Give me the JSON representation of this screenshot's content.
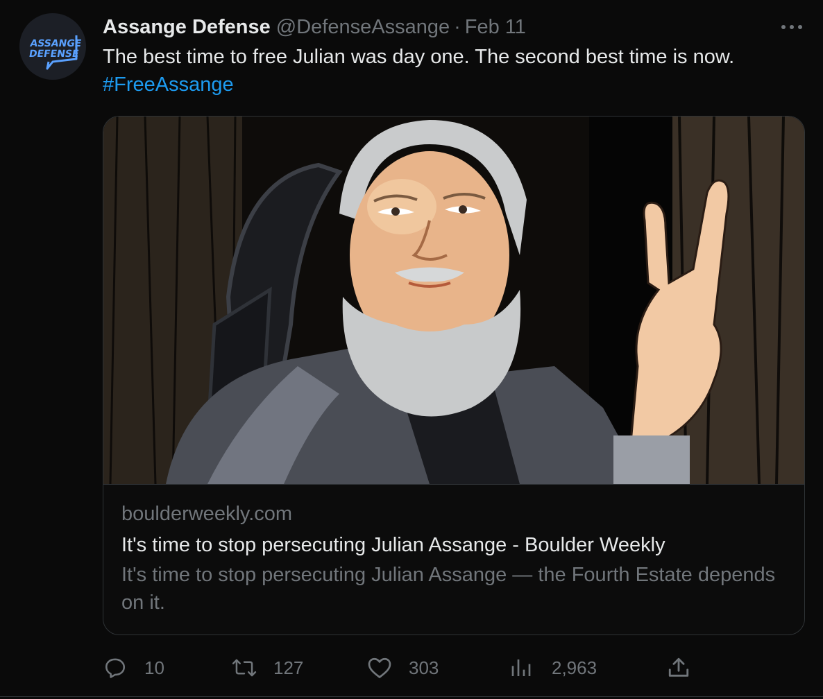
{
  "avatar": {
    "line1": "ASSANGE",
    "line2": "DEFENSE"
  },
  "author": {
    "display_name": "Assange Defense",
    "handle": "@DefenseAssange",
    "separator": "·",
    "date": "Feb 11"
  },
  "tweet": {
    "text": "The best time to free Julian was day one. The second best time is now.",
    "hashtag": "#FreeAssange"
  },
  "card": {
    "domain": "boulderweekly.com",
    "title": "It's time to stop persecuting Julian Assange - Boulder Weekly",
    "description": "It's time to stop persecuting Julian Assange — the Fourth Estate depends on it."
  },
  "actions": {
    "replies": "10",
    "retweets": "127",
    "likes": "303",
    "views": "2,963"
  },
  "colors": {
    "background": "#0a0a0a",
    "text": "#e7e9ea",
    "muted": "#71767b",
    "accent": "#1d9bf0",
    "border": "#2f3336"
  },
  "icons": [
    "more-icon",
    "reply-icon",
    "retweet-icon",
    "like-icon",
    "views-icon",
    "share-icon"
  ]
}
